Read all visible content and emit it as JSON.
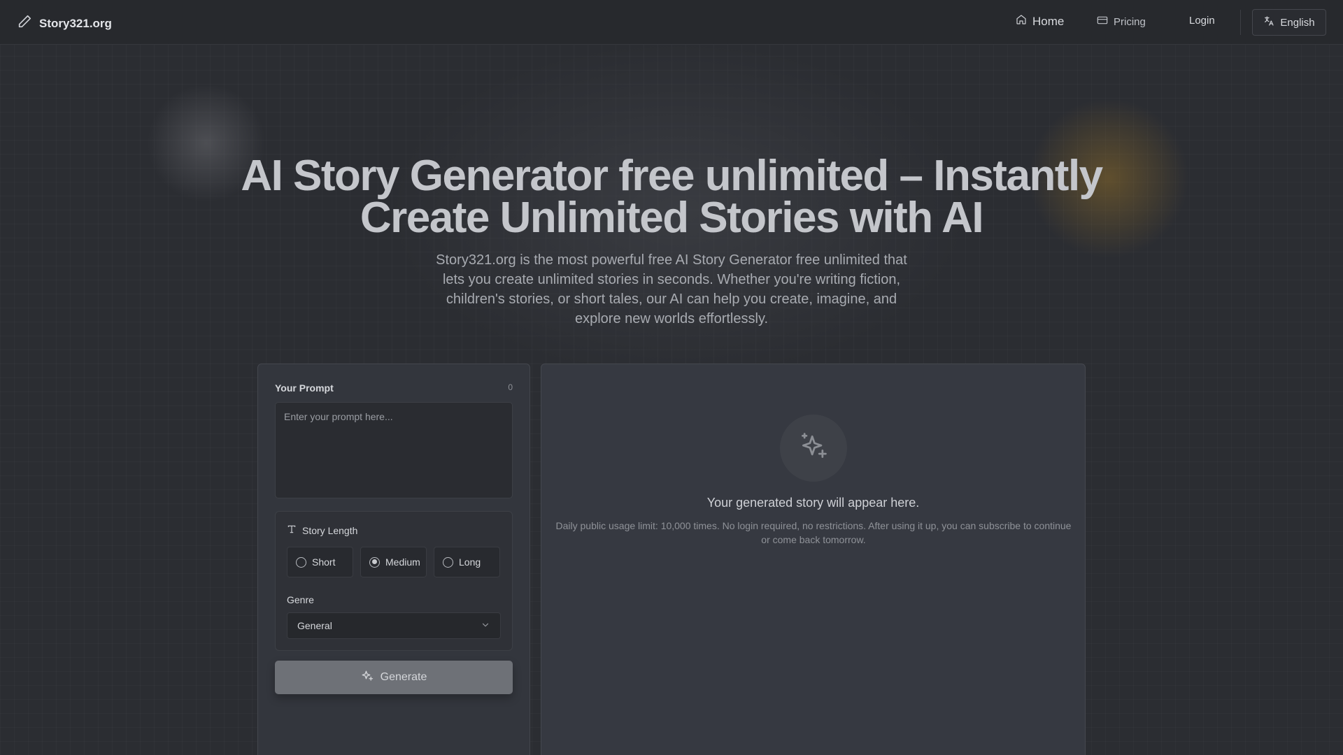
{
  "header": {
    "brand": "Story321.org",
    "nav": {
      "home": "Home",
      "pricing": "Pricing",
      "login": "Login",
      "language": "English"
    }
  },
  "hero": {
    "title_line1": "AI Story Generator free unlimited – Instantly",
    "title_line2": "Create Unlimited Stories with AI",
    "description": "Story321.org is the most powerful free AI Story Generator free unlimited that lets you create unlimited stories in seconds. Whether you're writing fiction, children's stories, or short tales, our AI can help you create, imagine, and explore new worlds effortlessly."
  },
  "form": {
    "prompt_label": "Your Prompt",
    "prompt_count": "0",
    "prompt_value": "",
    "prompt_placeholder": "Enter your prompt here...",
    "story_length_label": "Story Length",
    "length_options": [
      {
        "label": "Short",
        "checked": false
      },
      {
        "label": "Medium",
        "checked": true
      },
      {
        "label": "Long",
        "checked": false
      }
    ],
    "genre_label": "Genre",
    "genre_selected": "General",
    "generate_label": "Generate"
  },
  "result": {
    "title": "Your generated story will appear here.",
    "note": "Daily public usage limit: 10,000 times. No login required, no restrictions. After using it up, you can subscribe to continue or come back tomorrow."
  },
  "colors": {
    "background": "#2b2d32",
    "panel": "#33363d",
    "generate_button": "#6e7177"
  }
}
